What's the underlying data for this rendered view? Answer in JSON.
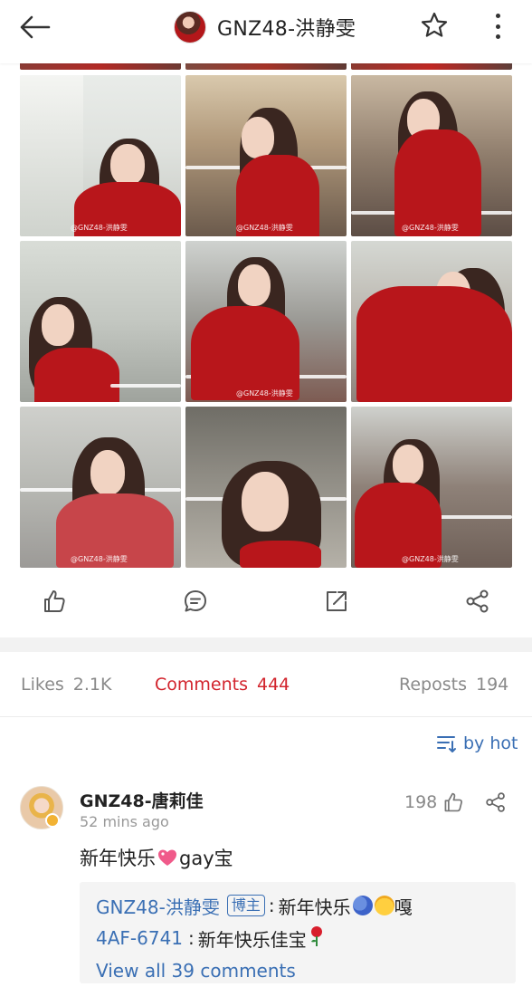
{
  "header": {
    "back_icon": "arrow-left-icon",
    "title": "GNZ48-洪静雯",
    "favorite_icon": "star-outline-icon",
    "more_icon": "more-vertical-icon"
  },
  "photos": {
    "watermark": "@GNZ48-洪静雯",
    "items": [
      {
        "scene": "street-looking-up"
      },
      {
        "scene": "bus-side-glance"
      },
      {
        "scene": "bus-seat-smile"
      },
      {
        "scene": "street-portrait"
      },
      {
        "scene": "bus-rail"
      },
      {
        "scene": "arm-raised-smile"
      },
      {
        "scene": "bus-seats-portrait"
      },
      {
        "scene": "close-up-portrait"
      },
      {
        "scene": "bus-top-city"
      }
    ]
  },
  "post_actions": {
    "like_icon": "thumbs-up-icon",
    "comment_icon": "comment-bubble-icon",
    "repost_icon": "repost-share-icon",
    "share_icon": "share-nodes-icon"
  },
  "tabs": {
    "likes_label": "Likes",
    "likes_count": "2.1K",
    "comments_label": "Comments",
    "comments_count": "444",
    "reposts_label": "Reposts",
    "reposts_count": "194"
  },
  "sort": {
    "icon": "sort-lines-icon",
    "label": "by hot"
  },
  "comment": {
    "author": "GNZ48-唐莉佳",
    "time": "52  mins ago",
    "likes": "198",
    "text_before": "新年快乐",
    "text_emoji": "heart-sparkle-icon",
    "text_after": "gay宝",
    "replies": [
      {
        "name": "GNZ48-洪静雯",
        "tag": "博主",
        "sep": ":",
        "text": "新年快乐",
        "emojis": [
          "hug-emoji-icon",
          "laughing-tears-emoji-icon"
        ],
        "tail": "嘎"
      },
      {
        "name": "4AF-6741",
        "sep": ":",
        "text": "新年快乐佳宝",
        "emoji": "rose-emoji-icon"
      }
    ],
    "view_all": "View all 39 comments"
  },
  "colors": {
    "accent_red": "#d2242d",
    "link_blue": "#3a6fb4",
    "coat_red": "#b8161b"
  }
}
